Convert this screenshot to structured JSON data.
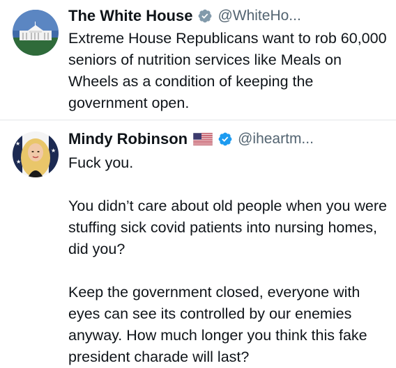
{
  "tweets": [
    {
      "author": {
        "display_name": "The White House",
        "handle": "@WhiteHo...",
        "verified": "gray",
        "avatar": "white-house-building"
      },
      "text": [
        "Extreme House Republicans want to rob 60,000 seniors of nutrition services like Meals on Wheels as a condition of keeping the government open."
      ]
    },
    {
      "author": {
        "display_name": "Mindy Robinson",
        "handle": "@iheartm...",
        "flag": "us-flag",
        "verified": "blue",
        "avatar": "woman-blonde-hair"
      },
      "text": [
        "Fuck you.",
        "You didn’t care about old people when you were stuffing sick covid patients into nursing homes, did you?",
        "Keep the government closed, everyone with eyes can see its controlled by our enemies anyway. How much longer you think this fake president charade will last?"
      ]
    }
  ],
  "colors": {
    "text": "#0f1419",
    "handle": "#536471",
    "verified_gray": "#829aab",
    "verified_blue": "#1d9bf0",
    "divider": "#e3e6e9"
  }
}
